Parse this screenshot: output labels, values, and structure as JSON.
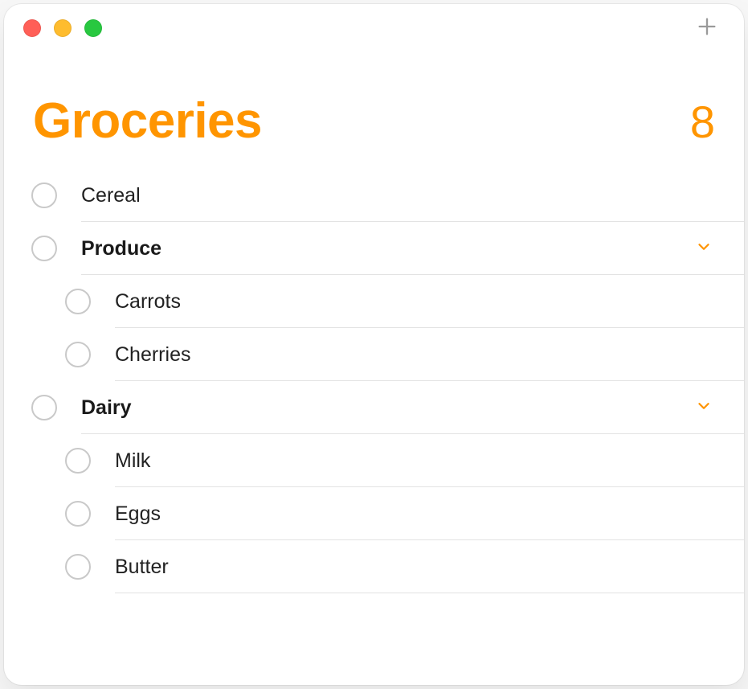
{
  "accent_color": "#ff9500",
  "window": {
    "title": "Groceries",
    "count": "8"
  },
  "items": [
    {
      "label": "Cereal"
    },
    {
      "label": "Produce",
      "group": true,
      "children": [
        {
          "label": "Carrots"
        },
        {
          "label": "Cherries"
        }
      ]
    },
    {
      "label": "Dairy",
      "group": true,
      "children": [
        {
          "label": "Milk"
        },
        {
          "label": "Eggs"
        },
        {
          "label": "Butter"
        }
      ]
    }
  ]
}
